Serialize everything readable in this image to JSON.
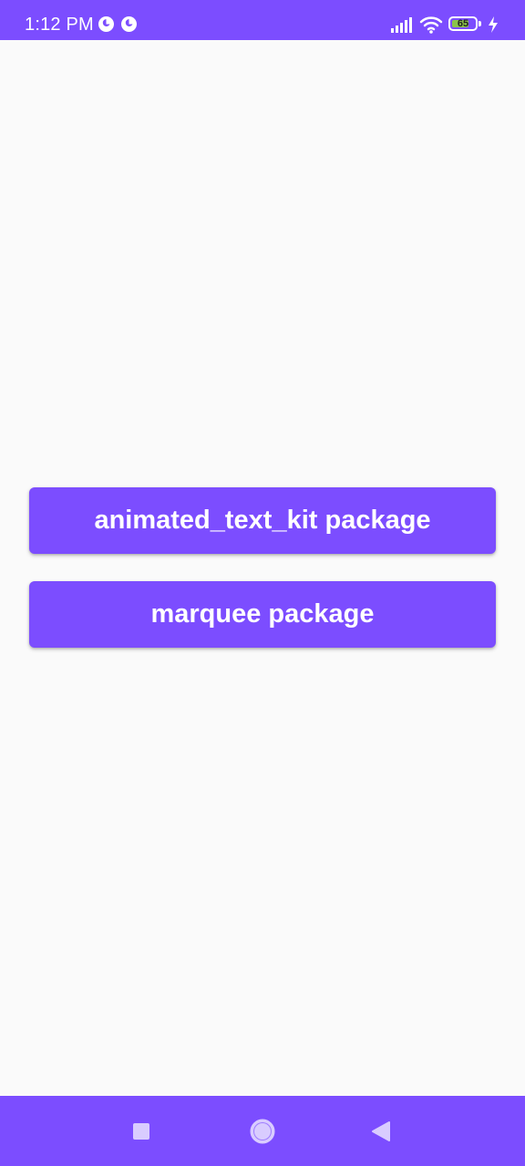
{
  "status_bar": {
    "time": "1:12 PM",
    "battery_level": "65",
    "icons": [
      "app-notification-icon",
      "app-notification-icon",
      "signal-icon",
      "wifi-icon",
      "battery-icon",
      "charging-icon"
    ]
  },
  "main": {
    "buttons": [
      {
        "label": "animated_text_kit package"
      },
      {
        "label": "marquee package"
      }
    ]
  },
  "nav_bar": {
    "icons": [
      "recents-icon",
      "home-icon",
      "back-icon"
    ]
  },
  "colors": {
    "primary": "#7c4dff",
    "background": "#fafafa",
    "text_on_primary": "#ffffff",
    "battery": "#8bc34a"
  }
}
